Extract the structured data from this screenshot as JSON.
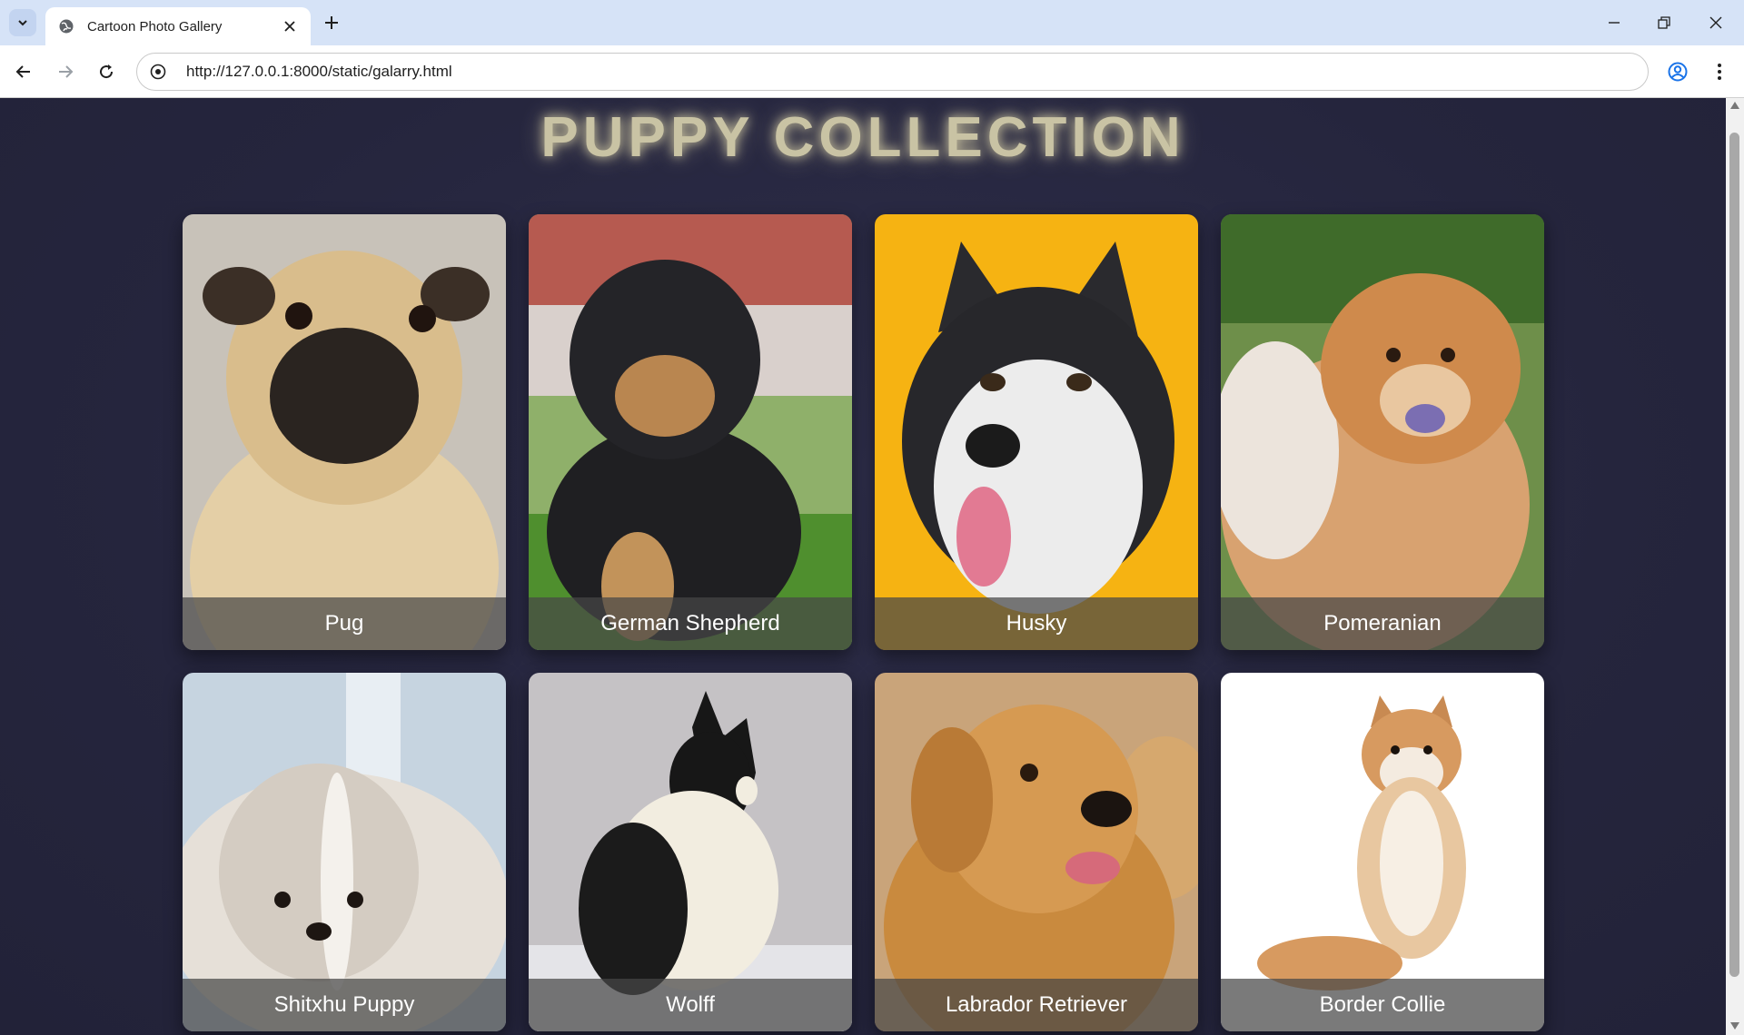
{
  "browser": {
    "tab_title": "Cartoon Photo Gallery",
    "url": "http://127.0.0.1:8000/static/galarry.html",
    "icons": {
      "tab_list": "chevron-down-icon",
      "favicon": "globe-icon",
      "tab_close": "close-icon",
      "new_tab": "plus-icon",
      "minimize": "minimize-icon",
      "restore": "restore-icon",
      "window_close": "close-icon",
      "back": "arrow-left-icon",
      "forward": "arrow-right-icon",
      "reload": "reload-icon",
      "site_info": "site-info-icon",
      "profile": "profile-icon",
      "menu": "kebab-menu-icon"
    }
  },
  "page": {
    "title": "PUPPY COLLECTION",
    "cards": [
      {
        "name": "Pug",
        "photo": "pug-photo"
      },
      {
        "name": "German Shepherd",
        "photo": "german-shepherd-photo"
      },
      {
        "name": "Husky",
        "photo": "husky-photo"
      },
      {
        "name": "Pomeranian",
        "photo": "pomeranian-photo"
      },
      {
        "name": "Shitxhu Puppy",
        "photo": "shitxhu-puppy-photo"
      },
      {
        "name": "Wolff",
        "photo": "wolff-photo"
      },
      {
        "name": "Labrador Retriever",
        "photo": "labrador-retriever-photo"
      },
      {
        "name": "Border Collie",
        "photo": "border-collie-photo"
      }
    ]
  },
  "colors": {
    "page_background": "#25253d",
    "title_glow": "#c9c3a4",
    "caption_overlay": "rgba(70,70,70,0.72)",
    "chrome_tabbar": "#d6e3f7"
  }
}
